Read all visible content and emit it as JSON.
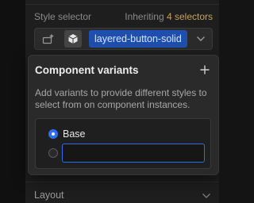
{
  "style_selector": {
    "title": "Style selector",
    "inheriting_prefix": "Inheriting",
    "inheriting_count": "4 selectors",
    "selected_class": "layered-button-solid"
  },
  "popover": {
    "title": "Component variants",
    "add_icon": "plus-icon",
    "description": "Add variants to provide different styles to select from on component instances.",
    "variants": [
      {
        "label": "Base",
        "selected": true
      }
    ],
    "new_variant_value": ""
  },
  "sections": {
    "layout_label": "Layout"
  },
  "colors": {
    "accent": "#2e6ef5",
    "chip": "#1f4fae",
    "inherit_count": "#c7a25a",
    "panel_bg": "#1e1e1e",
    "popover_bg": "#2a2a2a"
  }
}
